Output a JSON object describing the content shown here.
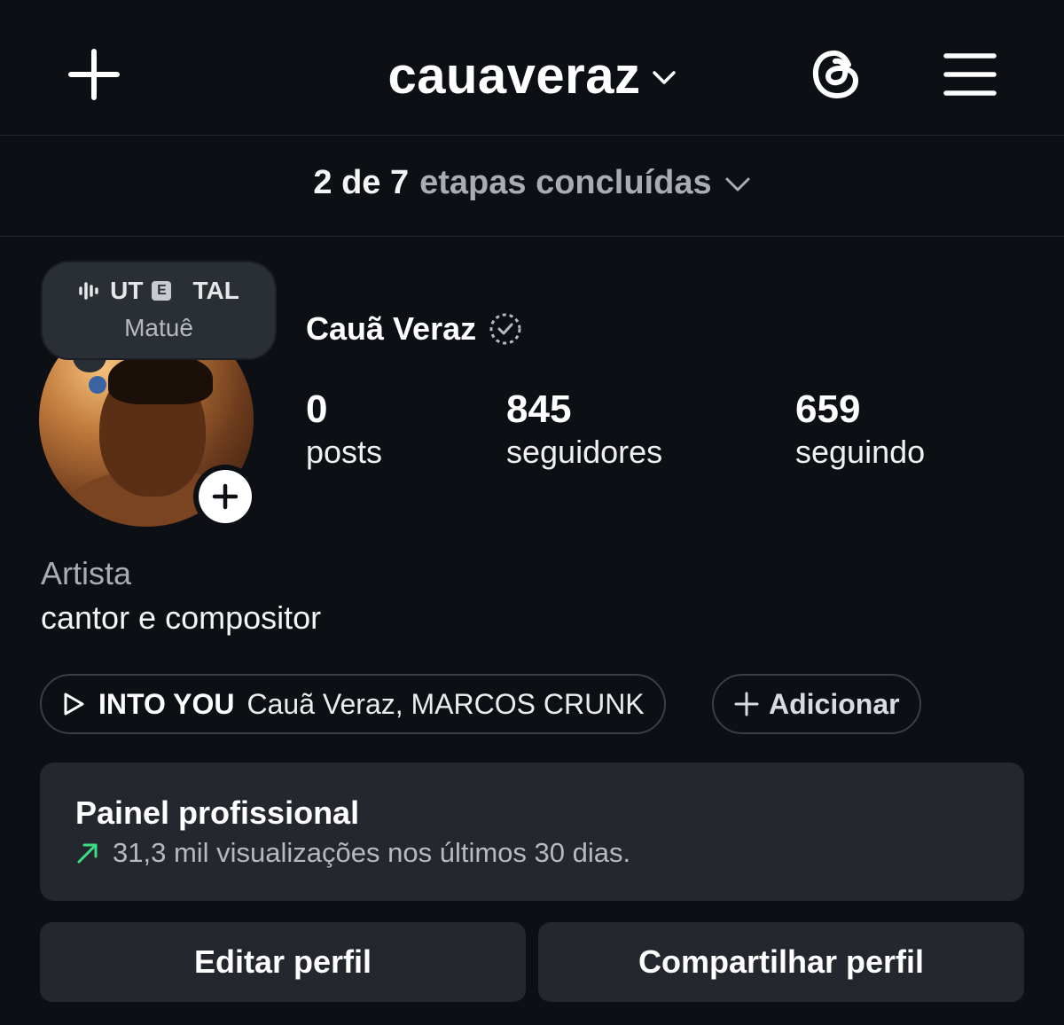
{
  "header": {
    "username": "cauaveraz"
  },
  "steps": {
    "done": "2 de 7",
    "rest": "etapas concluídas"
  },
  "note": {
    "song_fragment_a": "UT",
    "badge": "E",
    "song_fragment_b": "TAL",
    "artist": "Matuê"
  },
  "profile": {
    "display_name": "Cauã Veraz",
    "category": "Artista",
    "bio": "cantor e compositor"
  },
  "stats": {
    "posts": {
      "value": "0",
      "label": "posts"
    },
    "followers": {
      "value": "845",
      "label": "seguidores"
    },
    "following": {
      "value": "659",
      "label": "seguindo"
    }
  },
  "music": {
    "song": "INTO YOU",
    "artists": "Cauã Veraz, MARCOS CRUNK"
  },
  "add_chip": {
    "label": "Adicionar"
  },
  "dashboard": {
    "title": "Painel profissional",
    "subtitle": "31,3 mil visualizações nos últimos 30 dias."
  },
  "buttons": {
    "edit": "Editar perfil",
    "share": "Compartilhar perfil"
  },
  "colors": {
    "background": "#0c0f14",
    "card": "#24272d",
    "trend_green": "#3ddc84"
  }
}
